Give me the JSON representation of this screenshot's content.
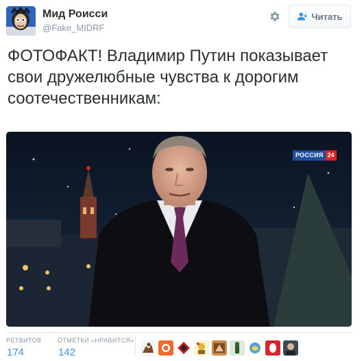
{
  "user": {
    "name": "Мид Роисси",
    "handle": "@Fake_MIDRF"
  },
  "actions": {
    "follow_label": "Читать",
    "follow_icon": "add-user-icon",
    "settings_icon": "gear-icon"
  },
  "tweet": {
    "text": "ФОТОФАКТ! Владимир Путин показывает свои дружелюбные чувства к дорогим соотечественникам:"
  },
  "media": {
    "channel_name": "РОССИЯ",
    "channel_number": "24"
  },
  "stats": {
    "retweets_label": "РЕТВИТОВ",
    "retweets_value": "174",
    "likes_label": "ОТМЕТКИ «НРАВИТСЯ»",
    "likes_value": "142"
  },
  "colors": {
    "link": "#3b94d9",
    "muted": "#8899a6",
    "text": "#292f33",
    "channel_blue": "#1d4fa0",
    "channel_red": "#e31f26"
  }
}
